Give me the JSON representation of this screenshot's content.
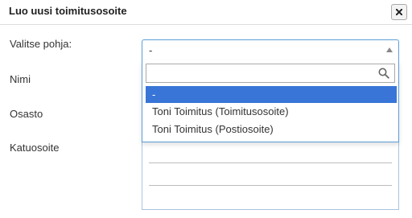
{
  "dialog": {
    "title": "Luo uusi toimitusosoite",
    "close_icon": "close-icon"
  },
  "form": {
    "template_label": "Valitse pohja:",
    "name_label": "Nimi",
    "department_label": "Osasto",
    "street_label": "Katuosoite"
  },
  "template_select": {
    "selected_value": "-",
    "search_value": "",
    "search_icon": "search-icon",
    "options": [
      "-",
      "Toni Toimitus (Toimitusosoite)",
      "Toni Toimitus (Postiosoite)"
    ],
    "highlighted_index": 0
  },
  "colors": {
    "accent": "#3875d7",
    "focus_border": "#5b9dd9"
  }
}
